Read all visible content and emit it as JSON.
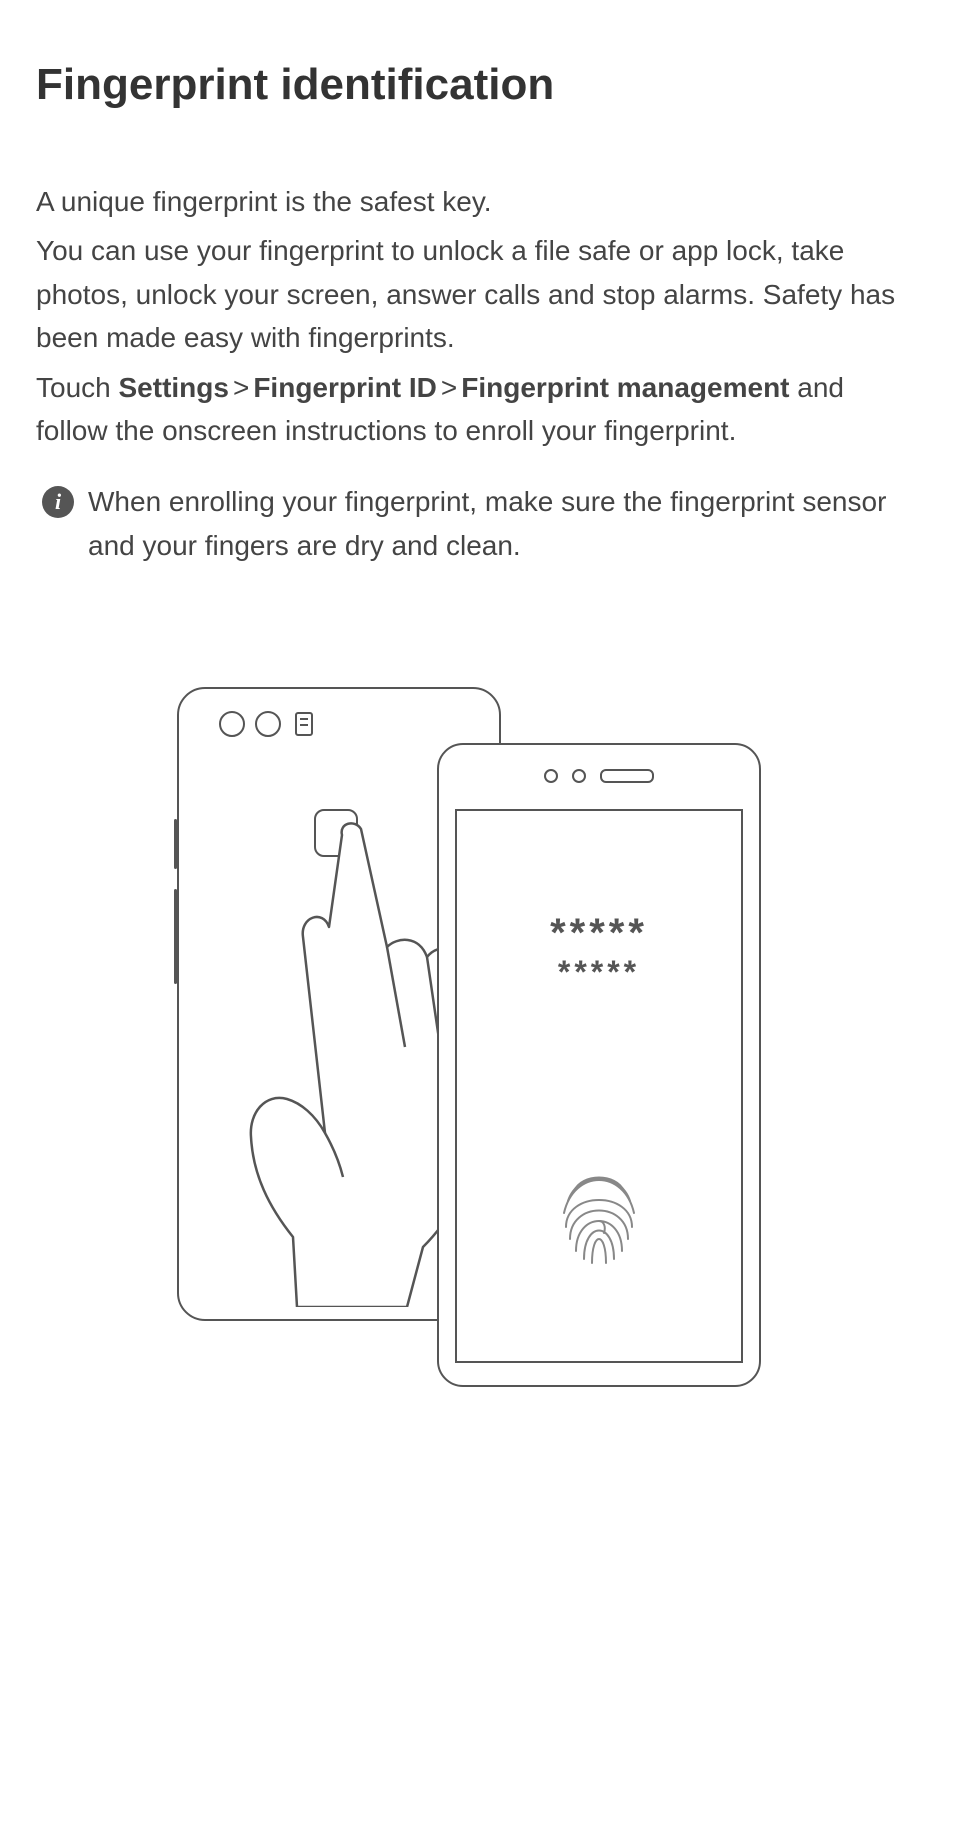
{
  "heading": "Fingerprint identification",
  "intro_line": "A unique fingerprint is the safest key.",
  "para1": "You can use your fingerprint to unlock a file safe or app lock, take photos, unlock your screen, answer calls and stop alarms. Safety has been made easy with fingerprints.",
  "instruction": {
    "prefix": "Touch ",
    "path_item_1": "Settings",
    "sep": ">",
    "path_item_2": "Fingerprint ID",
    "path_item_3": "Fingerprint management",
    "suffix": " and follow the onscreen instructions to enroll your fingerprint."
  },
  "tip": {
    "icon_label": "i",
    "text": "When enrolling your fingerprint, make sure the fingerprint sensor and your fingers are dry and clean."
  },
  "figure": {
    "password_line_1": "*****",
    "password_line_2": "*****"
  }
}
